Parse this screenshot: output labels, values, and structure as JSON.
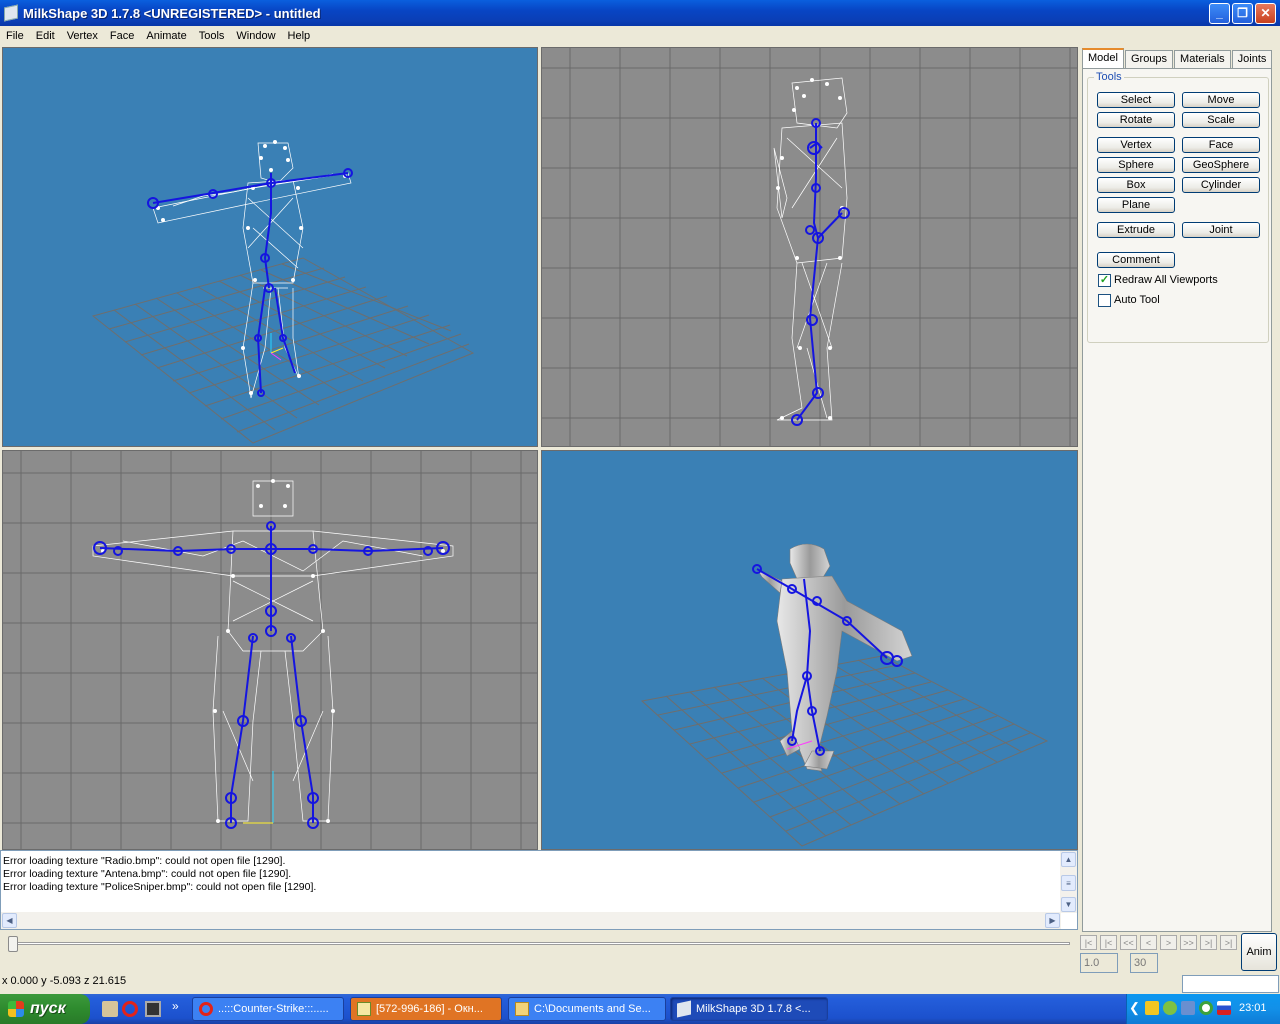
{
  "window": {
    "title": "MilkShape 3D 1.7.8 <UNREGISTERED> - untitled",
    "minimize": "_",
    "restore": "❐",
    "close": "✕"
  },
  "menu": [
    "File",
    "Edit",
    "Vertex",
    "Face",
    "Animate",
    "Tools",
    "Window",
    "Help"
  ],
  "colors": {
    "viewport_blue": "#3A80B5",
    "viewport_grey": "#8C8C8C",
    "skeleton": "#1515E0",
    "mesh": "#FFFFFF"
  },
  "viewports": [
    {
      "name": "3d-wireframe",
      "background": "blue"
    },
    {
      "name": "side-view",
      "background": "grey"
    },
    {
      "name": "front-view",
      "background": "grey"
    },
    {
      "name": "3d-shaded",
      "background": "blue"
    }
  ],
  "panel": {
    "tabs": [
      "Model",
      "Groups",
      "Materials",
      "Joints"
    ],
    "active_tab": "Model",
    "group_title": "Tools",
    "buttons": {
      "select": "Select",
      "move": "Move",
      "rotate": "Rotate",
      "scale": "Scale",
      "vertex": "Vertex",
      "face": "Face",
      "sphere": "Sphere",
      "geosphere": "GeoSphere",
      "box": "Box",
      "cylinder": "Cylinder",
      "plane": "Plane",
      "extrude": "Extrude",
      "joint": "Joint",
      "comment": "Comment"
    },
    "redraw_all": {
      "label": "Redraw All Viewports",
      "checked": true,
      "mark": "✓"
    },
    "auto_tool": {
      "label": "Auto Tool",
      "checked": false
    }
  },
  "log": [
    "Error loading texture \"Radio.bmp\": could not open file [1290].",
    "Error loading texture \"Antena.bmp\": could not open file [1290].",
    "Error loading texture \"PoliceSniper.bmp\": could not open file [1290]."
  ],
  "animation": {
    "buttons": [
      "|<",
      "|<",
      "<<",
      "<",
      ">",
      ">>",
      ">|",
      ">|"
    ],
    "current_frame": "1.0",
    "total_frames": "30",
    "anim_label": "Anim",
    "slider_position": 0
  },
  "status": {
    "coords": "x 0.000 y -5.093 z 21.615"
  },
  "taskbar": {
    "start": "пуск",
    "tasks": [
      {
        "label": "..:::Counter-Strike:::.....",
        "icon": "opera-icon"
      },
      {
        "label": "[572-996-186] - Окн...",
        "icon": "chat-icon"
      },
      {
        "label": "C:\\Documents and Se...",
        "icon": "folder-icon"
      },
      {
        "label": "MilkShape 3D 1.7.8 <...",
        "icon": "milkshape-icon"
      }
    ],
    "overflow": "»",
    "tray_expand": "❮",
    "clock": "23:01"
  }
}
